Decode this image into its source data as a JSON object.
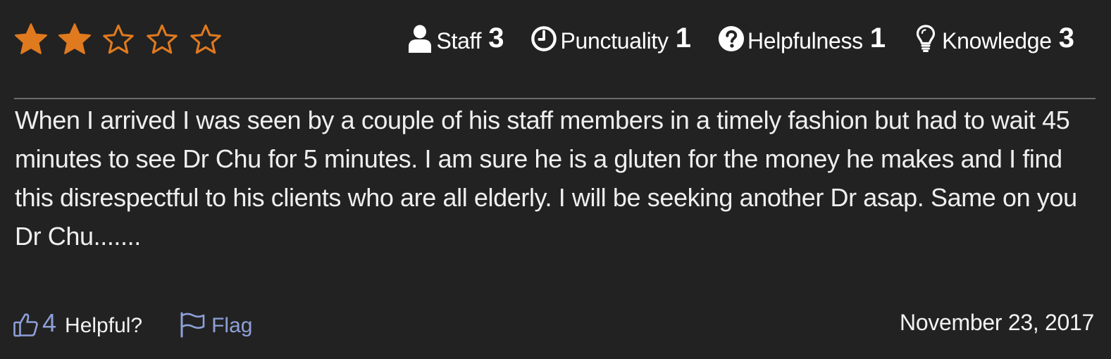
{
  "rating": {
    "value": 2,
    "max": 5,
    "filled_color": "#e07a1f",
    "empty_color": "#e07a1f",
    "stars": [
      {
        "icon": "star-filled-icon",
        "filled": true
      },
      {
        "icon": "star-filled-icon",
        "filled": true
      },
      {
        "icon": "star-outline-icon",
        "filled": false
      },
      {
        "icon": "star-outline-icon",
        "filled": false
      },
      {
        "icon": "star-outline-icon",
        "filled": false
      }
    ]
  },
  "metrics": [
    {
      "icon": "person-icon",
      "label": "Staff",
      "value": "3"
    },
    {
      "icon": "clock-icon",
      "label": "Punctuality",
      "value": "1"
    },
    {
      "icon": "question-icon",
      "label": "Helpfulness",
      "value": "1"
    },
    {
      "icon": "lightbulb-icon",
      "label": "Knowledge",
      "value": "3"
    }
  ],
  "review": {
    "text": "When I arrived I was seen by a couple of his staff members in a timely fashion but had to wait 45 minutes to see Dr Chu for 5 minutes. I am sure he is a gluten for the money he makes and I find this disrespectful to his clients who are all elderly. I will be seeking another Dr asap. Same on you Dr Chu.......",
    "date": "November 23, 2017"
  },
  "footer": {
    "helpful_icon": "thumbs-up-icon",
    "helpful_count": "4",
    "helpful_label": "Helpful?",
    "flag_icon": "flag-icon",
    "flag_label": "Flag",
    "link_color": "#8ea0d8"
  },
  "colors": {
    "background": "#222222",
    "text": "#efefef",
    "divider": "#6c6c6c"
  }
}
